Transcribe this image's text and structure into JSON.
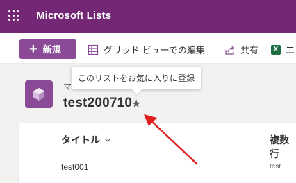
{
  "app": {
    "title": "Microsoft Lists",
    "brand_color": "#742774"
  },
  "command_bar": {
    "new_label": "新規",
    "grid_edit_label": "グリッド ビューでの編集",
    "share_label": "共有",
    "export_label": "エ",
    "accent_color": "#8a4a95"
  },
  "list": {
    "breadcrumb": "マ",
    "name": "test200710",
    "icon": "cube-icon"
  },
  "tooltip": {
    "text": "このリストをお気に入りに登録"
  },
  "grid": {
    "columns": [
      "タイトル",
      "複数行"
    ],
    "rows": [
      [
        "test001",
        "test"
      ]
    ]
  },
  "annotation": {
    "arrow_color": "#e02020"
  }
}
